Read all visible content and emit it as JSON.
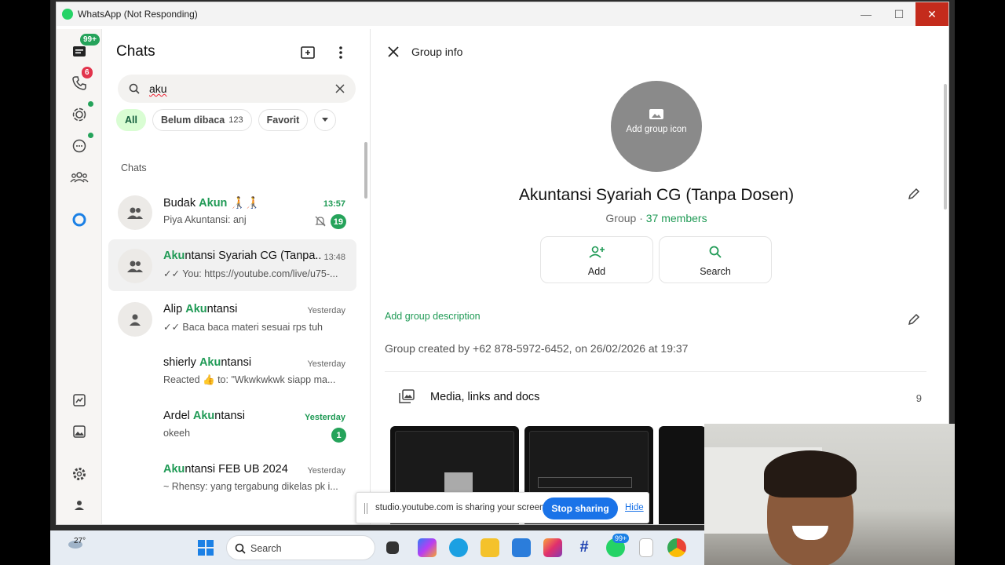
{
  "window": {
    "title": "WhatsApp (Not Responding)"
  },
  "rail": {
    "chats_badge": "99+",
    "calls_badge": "6"
  },
  "chatlist": {
    "title": "Chats",
    "search_value": "aku",
    "filters": [
      {
        "label": "All",
        "count": ""
      },
      {
        "label": "Belum dibaca",
        "count": "123"
      },
      {
        "label": "Favorit",
        "count": ""
      }
    ],
    "section_label": "Chats",
    "items": [
      {
        "name_pre": "Budak ",
        "name_hl": "Akun",
        "name_post": " 🧑‍🦯🧑‍🦯",
        "time": "13:57",
        "message": "Piya Akuntansi: anj",
        "unread": "19",
        "muted": true,
        "time_green": true
      },
      {
        "name_pre": "",
        "name_hl": "Aku",
        "name_post": "ntansi Syariah CG (Tanpa...",
        "time": "13:48",
        "message": "✓✓ You: https://youtube.com/live/u75-...",
        "unread": "",
        "muted": false,
        "time_green": false
      },
      {
        "name_pre": "Alip ",
        "name_hl": "Aku",
        "name_post": "ntansi",
        "time": "Yesterday",
        "message": "✓✓ Baca baca materi sesuai rps tuh",
        "unread": "",
        "muted": false,
        "time_green": false
      },
      {
        "name_pre": "shierly ",
        "name_hl": "Aku",
        "name_post": "ntansi",
        "time": "Yesterday",
        "message": "Reacted 👍 to: \"Wkwkwkwk siapp ma...",
        "unread": "",
        "muted": false,
        "time_green": false
      },
      {
        "name_pre": "Ardel ",
        "name_hl": "Aku",
        "name_post": "ntansi",
        "time": "Yesterday",
        "message": "okeeh",
        "unread": "1",
        "muted": false,
        "time_green": true
      },
      {
        "name_pre": "",
        "name_hl": "Aku",
        "name_post": "ntansi FEB UB 2024",
        "time": "Yesterday",
        "message": "~ Rhensy: yang tergabung dikelas pk i...",
        "unread": "",
        "muted": false,
        "time_green": false
      }
    ]
  },
  "info": {
    "header": "Group info",
    "icon_label": "Add group icon",
    "group_name": "Akuntansi Syariah CG (Tanpa Dosen)",
    "group_type": "Group · ",
    "members": "37 members",
    "actions": [
      {
        "label": "Add"
      },
      {
        "label": "Search"
      }
    ],
    "description_link": "Add group description",
    "created": "Group created by +62 878-5972-6452, on 26/02/2026 at 19:37",
    "media_label": "Media, links and docs",
    "media_count": "9"
  },
  "sharebar": {
    "text": "studio.youtube.com is sharing your screen.",
    "stop": "Stop sharing",
    "hide": "Hide"
  },
  "taskbar": {
    "temp": "27°",
    "search": "Search",
    "wa_badge": "99+"
  },
  "colors": {
    "accent": "#1f9a55",
    "unread": "#25a35a",
    "close": "#c42b1c",
    "share_blue": "#1a73e8"
  }
}
